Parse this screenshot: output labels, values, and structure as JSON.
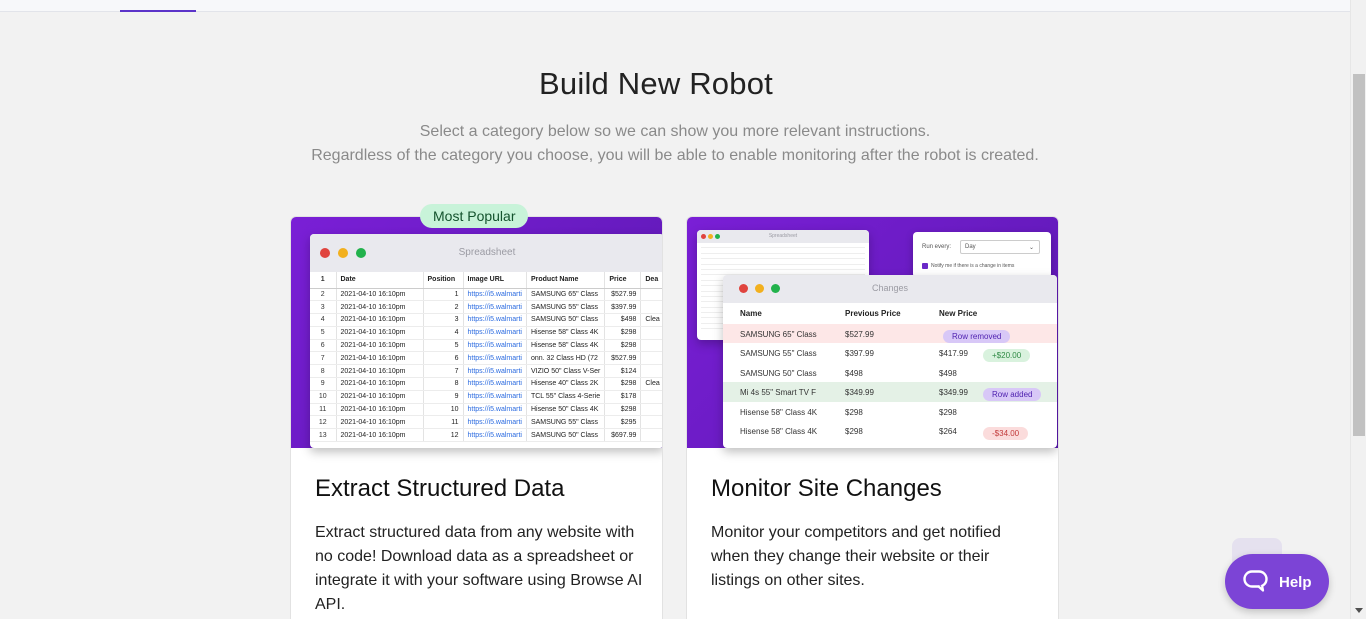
{
  "page": {
    "title": "Build New Robot",
    "subtitle_line1": "Select a category below so we can show you more relevant instructions.",
    "subtitle_line2": "Regardless of the category you choose, you will be able to enable monitoring after the robot is created."
  },
  "cards": [
    {
      "badge": "Most Popular",
      "title": "Extract Structured Data",
      "description": "Extract structured data from any website with no code! Download data as a spreadsheet or integrate it with your software using Browse AI API."
    },
    {
      "title": "Monitor Site Changes",
      "description": "Monitor your competitors and get notified when they change their website or their listings on other sites."
    }
  ],
  "spreadsheet": {
    "window_title": "Spreadsheet",
    "headers": [
      "1",
      "Date",
      "Position",
      "Image URL",
      "Product Name",
      "Price",
      "Dea"
    ],
    "rows": [
      [
        "2",
        "2021-04-10 16:10pm",
        "1",
        "https://i5.walmarti",
        "SAMSUNG 65\" Class",
        "$527.99",
        ""
      ],
      [
        "3",
        "2021-04-10 16:10pm",
        "2",
        "https://i5.walmarti",
        "SAMSUNG 55\" Class",
        "$397.99",
        ""
      ],
      [
        "4",
        "2021-04-10 16:10pm",
        "3",
        "https://i5.walmarti",
        "SAMSUNG 50\" Class",
        "$498",
        "Clea"
      ],
      [
        "5",
        "2021-04-10 16:10pm",
        "4",
        "https://i5.walmarti",
        "Hisense 58\" Class 4K",
        "$298",
        ""
      ],
      [
        "6",
        "2021-04-10 16:10pm",
        "5",
        "https://i5.walmarti",
        "Hisense 58\" Class 4K",
        "$298",
        ""
      ],
      [
        "7",
        "2021-04-10 16:10pm",
        "6",
        "https://i5.walmarti",
        "onn. 32 Class HD (72",
        "$527.99",
        ""
      ],
      [
        "8",
        "2021-04-10 16:10pm",
        "7",
        "https://i5.walmarti",
        "VIZIO 50\" Class V-Ser",
        "$124",
        ""
      ],
      [
        "9",
        "2021-04-10 16:10pm",
        "8",
        "https://i5.walmarti",
        "Hisense 40\" Class 2K",
        "$298",
        "Clea"
      ],
      [
        "10",
        "2021-04-10 16:10pm",
        "9",
        "https://i5.walmarti",
        "TCL 55\" Class 4-Serie",
        "$178",
        ""
      ],
      [
        "11",
        "2021-04-10 16:10pm",
        "10",
        "https://i5.walmarti",
        "Hisense 50\" Class 4K",
        "$298",
        ""
      ],
      [
        "12",
        "2021-04-10 16:10pm",
        "11",
        "https://i5.walmarti",
        "SAMSUNG 55\" Class",
        "$295",
        ""
      ],
      [
        "13",
        "2021-04-10 16:10pm",
        "12",
        "https://i5.walmarti",
        "SAMSUNG 50\" Class",
        "$697.99",
        ""
      ]
    ]
  },
  "monitor": {
    "mini_sheet_title": "Spreadsheet",
    "run_every_label": "Run every:",
    "run_every_value": "Day",
    "notify_label": "Notify me if there is a change in items",
    "changes_title": "Changes",
    "changes_headers": [
      "Name",
      "Previous Price",
      "New Price"
    ],
    "changes_rows": [
      {
        "name": "SAMSUNG 65\" Class",
        "prev": "$527.99",
        "new": "",
        "pill": "Row removed",
        "pill_type": "purple",
        "row_type": "removed"
      },
      {
        "name": "SAMSUNG 55\" Class",
        "prev": "$397.99",
        "new": "$417.99",
        "pill": "+$20.00",
        "pill_type": "green",
        "row_type": ""
      },
      {
        "name": "SAMSUNG 50\" Class",
        "prev": "$498",
        "new": "$498",
        "pill": "",
        "pill_type": "",
        "row_type": ""
      },
      {
        "name": "Mi 4s 55\" Smart TV F",
        "prev": "$349.99",
        "new": "$349.99",
        "pill": "Row added",
        "pill_type": "purple",
        "row_type": "added"
      },
      {
        "name": "Hisense 58\" Class 4K",
        "prev": "$298",
        "new": "$298",
        "pill": "",
        "pill_type": "",
        "row_type": ""
      },
      {
        "name": "Hisense 58\" Class 4K",
        "prev": "$298",
        "new": "$264",
        "pill": "-$34.00",
        "pill_type": "red",
        "row_type": ""
      }
    ]
  },
  "help": {
    "label": "Help",
    "icon": "chat-bubble-icon"
  },
  "colors": {
    "brand_purple": "#7a1fd6",
    "badge_green": "#c8f3d9",
    "help_button": "#7c44d6"
  }
}
